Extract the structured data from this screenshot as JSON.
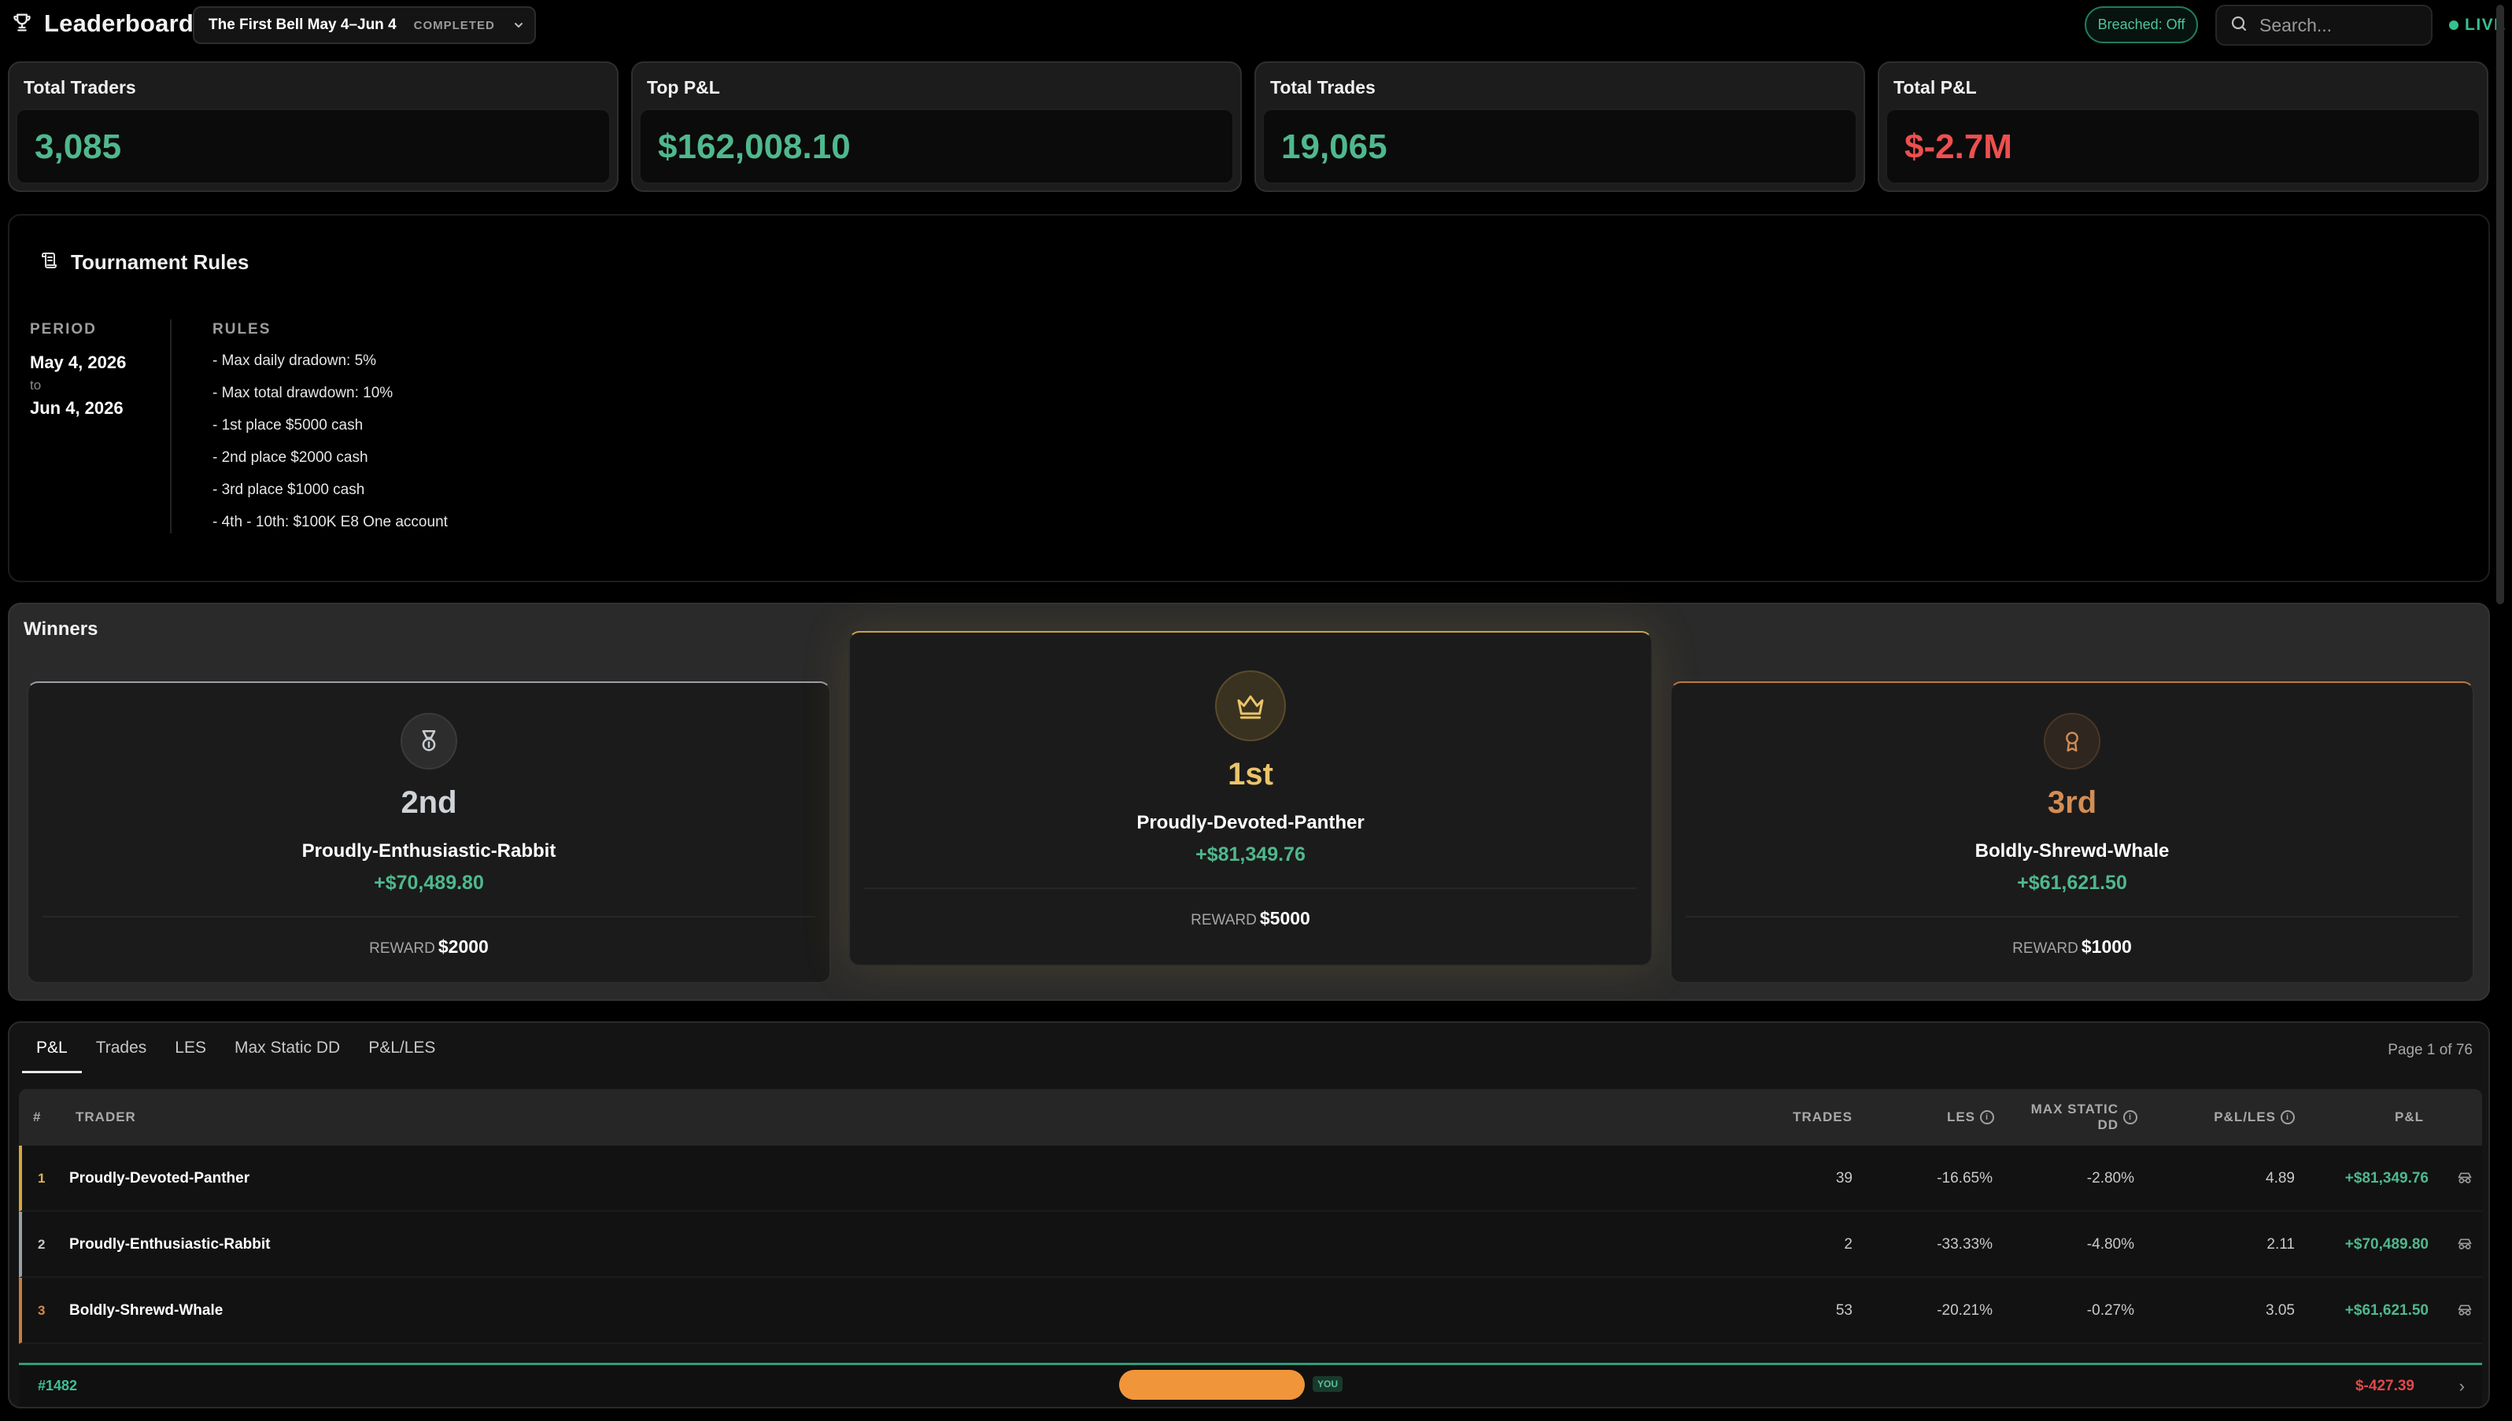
{
  "header": {
    "title": "Leaderboard",
    "tournament": {
      "name": "The First Bell May 4–Jun 4",
      "status": "COMPLETED"
    },
    "breached_toggle": "Breached: Off",
    "search": {
      "placeholder": "Search...",
      "value": ""
    },
    "live_label": "LIVE"
  },
  "stats": [
    {
      "label": "Total Traders",
      "value": "3,085"
    },
    {
      "label": "Top P&L",
      "value": "$162,008.10"
    },
    {
      "label": "Total Trades",
      "value": "19,065"
    },
    {
      "label": "Total P&L",
      "value": "$-2.7M"
    }
  ],
  "rules_panel": {
    "title": "Tournament Rules",
    "period_caption": "PERIOD",
    "period_start": "May 4, 2026",
    "period_to": "to",
    "period_end": "Jun 4, 2026",
    "rules_caption": "RULES",
    "rules": [
      "- Max daily dradown: 5%",
      "- Max total drawdown: 10%",
      "- 1st place $5000 cash",
      "- 2nd place $2000 cash",
      "- 3rd place $1000 cash",
      "- 4th - 10th: $100K E8 One account"
    ]
  },
  "winners": {
    "title": "Winners",
    "second": {
      "place": "2nd",
      "name": "Proudly-Enthusiastic-Rabbit",
      "pnl": "+$70,489.80",
      "reward_label": "REWARD",
      "reward": "$2000"
    },
    "first": {
      "place": "1st",
      "name": "Proudly-Devoted-Panther",
      "pnl": "+$81,349.76",
      "reward_label": "REWARD",
      "reward": "$5000"
    },
    "third": {
      "place": "3rd",
      "name": "Boldly-Shrewd-Whale",
      "pnl": "+$61,621.50",
      "reward_label": "REWARD",
      "reward": "$1000"
    }
  },
  "table": {
    "tabs": [
      "P&L",
      "Trades",
      "LES",
      "Max Static DD",
      "P&L/LES"
    ],
    "active_tab": "P&L",
    "page_info": "Page 1 of 76",
    "columns": {
      "rank": "#",
      "trader": "TRADER",
      "trades": "TRADES",
      "les": "LES",
      "max_static_dd_1": "MAX STATIC",
      "max_static_dd_2": "DD",
      "pnl_les": "P&L/LES",
      "pnl": "P&L"
    },
    "rows": [
      {
        "rank": "1",
        "trader": "Proudly-Devoted-Panther",
        "trades": "39",
        "les": "-16.65%",
        "max_dd": "-2.80%",
        "pnl_les": "4.89",
        "pnl": "+$81,349.76"
      },
      {
        "rank": "2",
        "trader": "Proudly-Enthusiastic-Rabbit",
        "trades": "2",
        "les": "-33.33%",
        "max_dd": "-4.80%",
        "pnl_les": "2.11",
        "pnl": "+$70,489.80"
      },
      {
        "rank": "3",
        "trader": "Boldly-Shrewd-Whale",
        "trades": "53",
        "les": "-20.21%",
        "max_dd": "-0.27%",
        "pnl_les": "3.05",
        "pnl": "+$61,621.50"
      }
    ],
    "you": {
      "rank": "#1482",
      "badge": "YOU",
      "pnl": "$-427.39"
    }
  },
  "colors": {
    "positive": "#4fb88e",
    "negative": "#ef4f4f",
    "gold": "#e9c46a",
    "silver": "#cfd3d7",
    "bronze": "#d38d55",
    "live": "#35c28f"
  }
}
